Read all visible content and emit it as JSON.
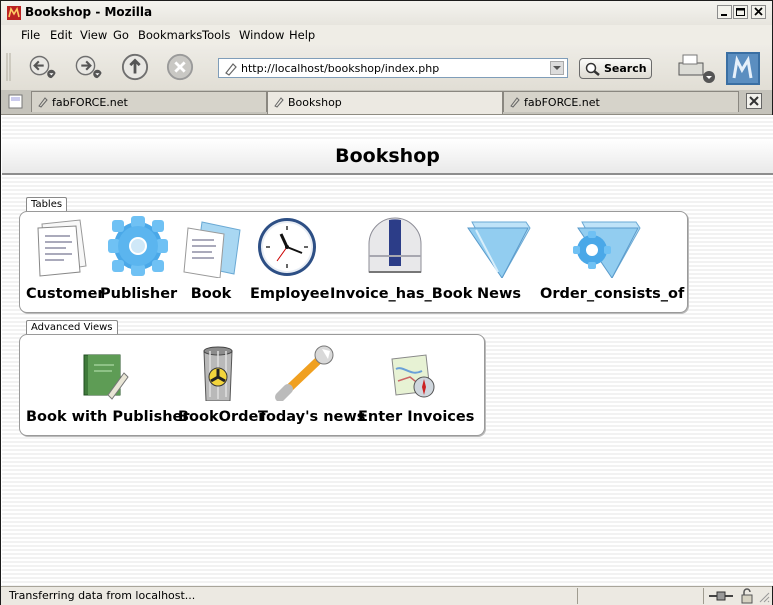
{
  "window": {
    "title": "Bookshop - Mozilla"
  },
  "menu": [
    "File",
    "Edit",
    "View",
    "Go",
    "Bookmarks",
    "Tools",
    "Window",
    "Help"
  ],
  "toolbar": {
    "url": "http://localhost/bookshop/index.php",
    "search_label": "Search"
  },
  "tabs": [
    {
      "label": "fabFORCE.net",
      "active": false
    },
    {
      "label": "Bookshop",
      "active": true
    },
    {
      "label": "fabFORCE.net",
      "active": false
    }
  ],
  "page": {
    "title": "Bookshop"
  },
  "groups": {
    "tables": {
      "label": "Tables",
      "items": [
        {
          "label": "Customer",
          "icon": "document-icon"
        },
        {
          "label": "Publisher",
          "icon": "gear-icon"
        },
        {
          "label": "Book",
          "icon": "documents-icon"
        },
        {
          "label": "Employee",
          "icon": "clock-icon"
        },
        {
          "label": "Invoice_has_Book",
          "icon": "observatory-icon"
        },
        {
          "label": "News",
          "icon": "folder-icon"
        },
        {
          "label": "Order_consists_of",
          "icon": "folder-gear-icon"
        }
      ]
    },
    "views": {
      "label": "Advanced Views",
      "items": [
        {
          "label": "Book with Publisher",
          "icon": "book-pen-icon"
        },
        {
          "label": "BookOrder",
          "icon": "trash-can-icon"
        },
        {
          "label": "Today's news",
          "icon": "wrench-icon"
        },
        {
          "label": "Enter Invoices",
          "icon": "map-compass-icon"
        }
      ]
    }
  },
  "status": {
    "text": "Transferring data from localhost..."
  },
  "colors": {
    "accent": "#2a6bd1",
    "header_border": "#8d8d8d"
  }
}
